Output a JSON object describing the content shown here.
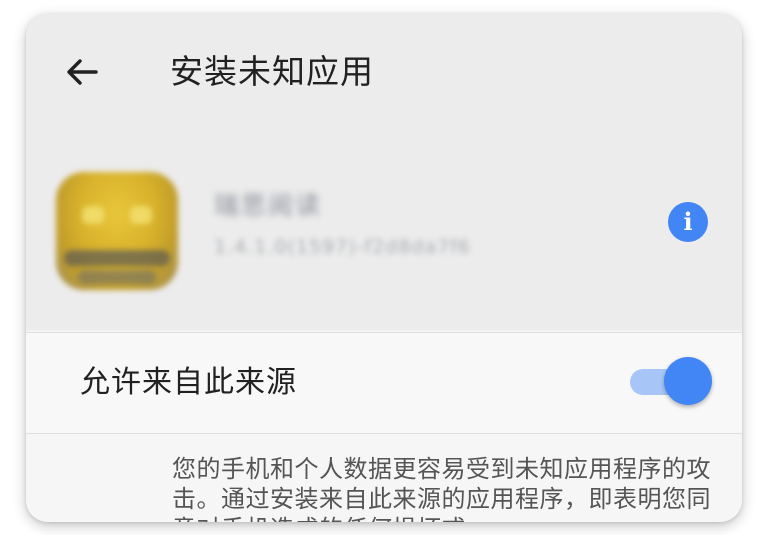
{
  "header": {
    "back_icon": "back-arrow-icon",
    "title": "安装未知应用"
  },
  "app": {
    "icon": "app-icon",
    "name": "瑞思阅读",
    "version": "1.4.1.0(1597)-f2d8da7f6",
    "info_icon": "info-icon",
    "info_glyph": "i"
  },
  "allow_source": {
    "label": "允许来自此来源",
    "enabled": true
  },
  "warning": {
    "text": "您的手机和个人数据更容易受到未知应用程序的攻击。通过安装来自此来源的应用程序，即表明您同意对手机造成的任何损坏或"
  },
  "colors": {
    "accent": "#4285f4",
    "toggle_track": "#a7c6f7",
    "header_bg": "#ececec",
    "title_text": "#212121",
    "body_text": "#555555"
  }
}
